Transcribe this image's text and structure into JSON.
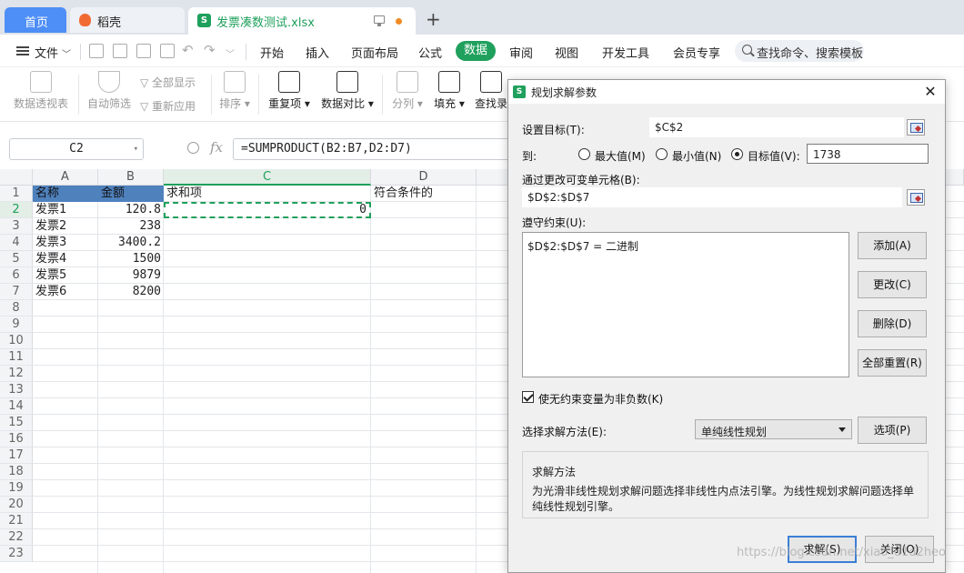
{
  "tabs": {
    "home": "首页",
    "shell": "稻壳",
    "file": "发票凑数测试.xlsx",
    "new_tab": "+"
  },
  "menu": {
    "file": "文件",
    "items": [
      "开始",
      "插入",
      "页面布局",
      "公式",
      "数据",
      "审阅",
      "视图",
      "开发工具",
      "会员专享"
    ],
    "active": "数据",
    "search": "查找命令、搜索模板"
  },
  "ribbon": {
    "pivot": "数据透视表",
    "autofilter": "自动筛选",
    "show_all": "全部显示",
    "reapply": "重新应用",
    "sort": "排序",
    "duplicates": "重复项",
    "compare": "数据对比",
    "split": "分列",
    "fill": "填充",
    "find": "查找录"
  },
  "formula_bar": {
    "name_box": "C2",
    "fx": "fx",
    "formula": "=SUMPRODUCT(B2:B7,D2:D7)"
  },
  "sheet": {
    "columns": [
      "A",
      "B",
      "C",
      "D"
    ],
    "selected_column": "C",
    "rows": [
      "1",
      "2",
      "3",
      "4",
      "5",
      "6",
      "7",
      "8",
      "9",
      "10",
      "11",
      "12",
      "13",
      "14",
      "15",
      "16",
      "17",
      "18",
      "19",
      "20",
      "21",
      "22",
      "23"
    ],
    "selected_row": "2",
    "headers": {
      "a1": "名称",
      "b1": "金额",
      "c1": "求和项",
      "d1": "符合条件的"
    },
    "data": [
      {
        "name": "发票1",
        "amount": "120.8"
      },
      {
        "name": "发票2",
        "amount": "238"
      },
      {
        "name": "发票3",
        "amount": "3400.2"
      },
      {
        "name": "发票4",
        "amount": "1500"
      },
      {
        "name": "发票5",
        "amount": "9879"
      },
      {
        "name": "发票6",
        "amount": "8200"
      }
    ],
    "c2": "0",
    "header_fill_color": "#4f81bd",
    "selection_color": "#1fa05c"
  },
  "solver": {
    "title": "规划求解参数",
    "close": "✕",
    "set_objective_label": "设置目标(T):",
    "objective": "$C$2",
    "to_label": "到:",
    "max": "最大值(M)",
    "min": "最小值(N)",
    "value_of": "目标值(V):",
    "target_value": "1738",
    "changing_label": "通过更改可变单元格(B):",
    "changing_cells": "$D$2:$D$7",
    "constraints_label": "遵守约束(U):",
    "constraints": [
      "$D$2:$D$7 = 二进制"
    ],
    "add": "添加(A)",
    "change": "更改(C)",
    "delete": "删除(D)",
    "reset_all": "全部重置(R)",
    "nonneg": "使无约束变量为非负数(K)",
    "method_label": "选择求解方法(E):",
    "method": "单纯线性规划",
    "options": "选项(P)",
    "method_box_title": "求解方法",
    "method_desc": "为光滑非线性规划求解问题选择非线性内点法引擎。为线性规划求解问题选择单纯线性规划引擎。",
    "solve": "求解(S)",
    "close_btn": "关闭(O)"
  },
  "watermark": "https://blog.csdn.net/xiao_u1d2heo"
}
